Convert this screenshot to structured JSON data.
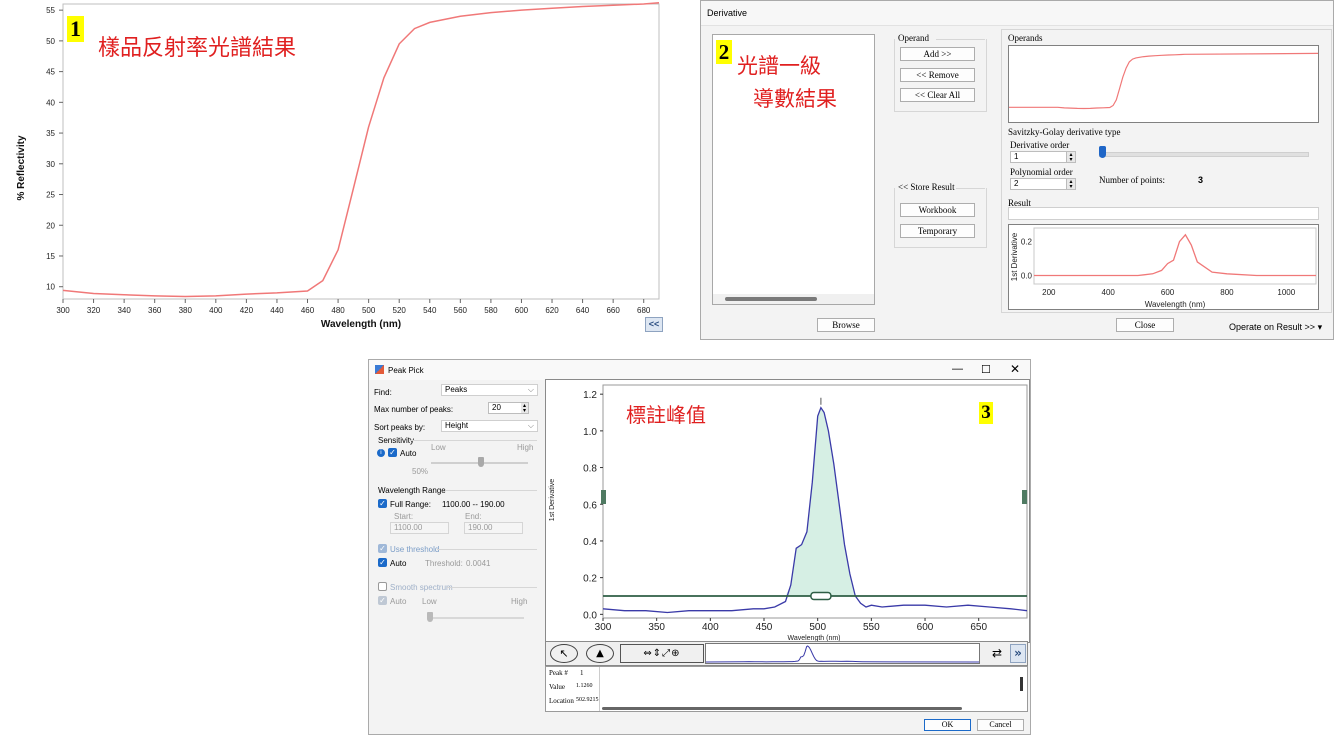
{
  "panel1": {
    "badge": "1",
    "caption": "樣品反射率光譜結果",
    "xlabel": "Wavelength (nm)",
    "ylabel": "% Reflectivity",
    "collapse_label": "<<"
  },
  "panel2": {
    "badge": "2",
    "caption_line1": "光譜一級",
    "caption_line2": "導數結果",
    "title": "Derivative",
    "operand_group": "Operand",
    "add_button": "Add >>",
    "remove_button": "<< Remove",
    "clear_all_button": "<< Clear All",
    "operands_label": "Operands",
    "sg_type_label": "Savitzky-Golay derivative type",
    "derivative_order_label": "Derivative order",
    "derivative_order_value": "1",
    "polynomial_order_label": "Polynomial order",
    "polynomial_order_value": "2",
    "number_of_points_label": "Number of points:",
    "number_of_points_value": "3",
    "store_result_label": "<< Store Result",
    "workbook_button": "Workbook",
    "temporary_button": "Temporary",
    "result_label": "Result",
    "result_ylabel": "1st Derivative",
    "result_xlabel": "Wavelength (nm)",
    "browse_button": "Browse",
    "close_button": "Close",
    "operate_button": "Operate on Result >>"
  },
  "panel3": {
    "badge": "3",
    "caption": "標註峰值",
    "title": "Peak Pick",
    "find_label": "Find:",
    "find_value": "Peaks",
    "max_peaks_label": "Max number of peaks:",
    "max_peaks_value": "20",
    "sort_label": "Sort peaks by:",
    "sort_value": "Height",
    "sensitivity_label": "Sensitivity",
    "auto_label": "Auto",
    "low_label": "Low",
    "high_label": "High",
    "sensitivity_value": "50%",
    "wl_range_label": "Wavelength Range",
    "full_range_label": "Full Range:",
    "full_range_value": "1100.00 -- 190.00",
    "start_label": "Start:",
    "start_value": "1100.00",
    "end_label": "End:",
    "end_value": "190.00",
    "use_threshold_label": "Use threshold",
    "auto2_label": "Auto",
    "threshold_label": "Threshold:",
    "threshold_value": "0.0041",
    "smooth_label": "Smooth spectrum",
    "auto3_label": "Auto",
    "low2_label": "Low",
    "high2_label": "High",
    "xlabel": "Wavelength (nm)",
    "ylabel": "1st Derivative",
    "table": {
      "peak_label": "Peak #",
      "peak_value": "1",
      "value_label": "Value",
      "value_value": "1.1260",
      "location_label": "Location",
      "location_value": "502.9215"
    },
    "ok_button": "OK",
    "cancel_button": "Cancel",
    "more_label": "»"
  },
  "colors": {
    "spectrum_red": "#f07878",
    "derivative_blue": "#3a3aa8",
    "peak_fill": "#d6efe4",
    "threshold_green": "#2e5e45",
    "caption_red": "#e02020"
  },
  "chart_data": [
    {
      "type": "line",
      "xlabel": "Wavelength (nm)",
      "ylabel": "% Reflectivity",
      "xlim": [
        300,
        690
      ],
      "ylim": [
        8,
        56
      ],
      "xticks": [
        300,
        320,
        340,
        360,
        380,
        400,
        420,
        440,
        460,
        480,
        500,
        520,
        540,
        560,
        580,
        600,
        620,
        640,
        660,
        680
      ],
      "yticks": [
        10,
        15,
        20,
        25,
        30,
        35,
        40,
        45,
        50,
        55
      ],
      "x": [
        300,
        320,
        340,
        360,
        380,
        400,
        420,
        440,
        460,
        470,
        480,
        490,
        500,
        510,
        520,
        530,
        540,
        560,
        580,
        600,
        620,
        640,
        660,
        680,
        690
      ],
      "y": [
        9.4,
        8.9,
        8.7,
        8.5,
        8.4,
        8.5,
        8.8,
        9.0,
        9.3,
        11,
        16,
        26,
        36,
        44,
        49.5,
        52,
        53,
        54,
        54.6,
        55,
        55.3,
        55.6,
        55.8,
        56,
        56.2
      ]
    },
    {
      "type": "line",
      "xlabel": "Wavelength (nm)",
      "ylabel": "1st Derivative",
      "xlim": [
        150,
        1100
      ],
      "ylim": [
        -0.05,
        0.28
      ],
      "xticks": [
        200,
        400,
        600,
        800,
        1000
      ],
      "yticks": [
        0.0,
        0.2
      ],
      "x": [
        150,
        200,
        300,
        400,
        500,
        550,
        580,
        600,
        620,
        640,
        660,
        680,
        700,
        750,
        800,
        900,
        1000,
        1100
      ],
      "y": [
        0.0,
        0.0,
        0.0,
        0.0,
        0.0,
        0.01,
        0.03,
        0.07,
        0.09,
        0.2,
        0.24,
        0.18,
        0.08,
        0.02,
        0.01,
        0.0,
        0.0,
        0.0
      ]
    },
    {
      "type": "line",
      "xlabel": "Wavelength (nm)",
      "ylabel": "1st Derivative",
      "xlim": [
        300,
        695
      ],
      "ylim": [
        -0.02,
        1.25
      ],
      "xticks": [
        300,
        350,
        400,
        450,
        500,
        550,
        600,
        650
      ],
      "yticks": [
        0.0,
        0.2,
        0.4,
        0.6,
        0.8,
        1.0,
        1.2
      ],
      "threshold": 0.1,
      "x": [
        300,
        320,
        340,
        360,
        380,
        400,
        420,
        440,
        450,
        460,
        470,
        475,
        480,
        485,
        490,
        495,
        500,
        503,
        506,
        510,
        515,
        520,
        525,
        530,
        535,
        540,
        545,
        550,
        560,
        580,
        600,
        620,
        640,
        660,
        680,
        695
      ],
      "y": [
        0.03,
        0.02,
        0.02,
        0.01,
        0.02,
        0.02,
        0.02,
        0.03,
        0.03,
        0.04,
        0.07,
        0.16,
        0.36,
        0.38,
        0.45,
        0.72,
        1.08,
        1.126,
        1.1,
        1.0,
        0.82,
        0.6,
        0.38,
        0.22,
        0.1,
        0.06,
        0.04,
        0.05,
        0.04,
        0.05,
        0.05,
        0.04,
        0.05,
        0.04,
        0.03,
        0.02
      ]
    }
  ]
}
